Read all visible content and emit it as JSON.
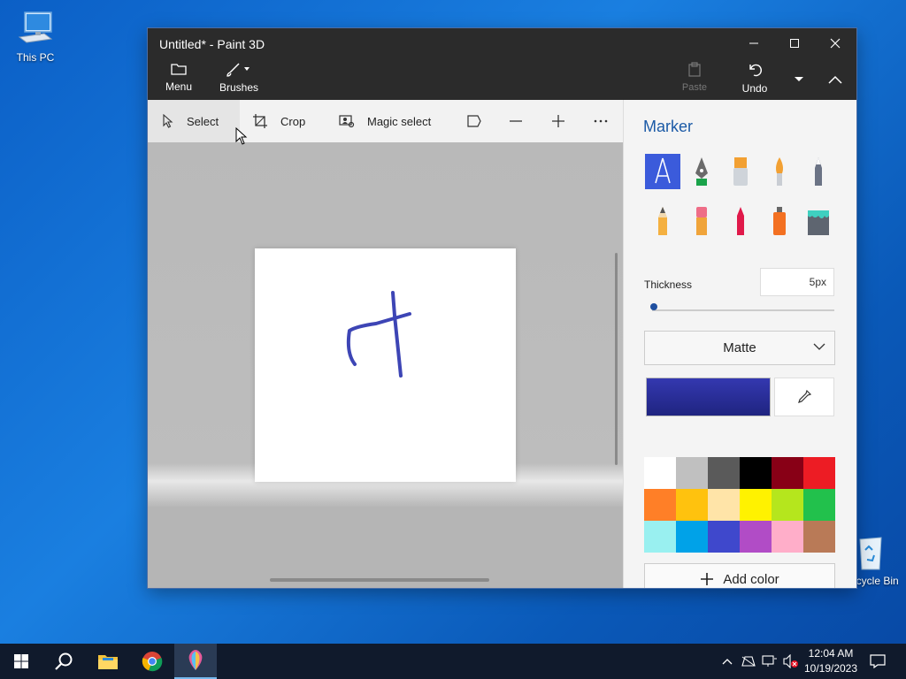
{
  "desktop": {
    "this_pc_label": "This PC",
    "recycle_label": "Recycle Bin"
  },
  "window": {
    "title": "Untitled* - Paint 3D"
  },
  "ribbon": {
    "menu_label": "Menu",
    "brushes_label": "Brushes",
    "paste_label": "Paste",
    "undo_label": "Undo"
  },
  "toolbar": {
    "select_label": "Select",
    "crop_label": "Crop",
    "magic_select_label": "Magic select"
  },
  "panel": {
    "title": "Marker",
    "thickness_label": "Thickness",
    "thickness_value": "5px",
    "finish_value": "Matte",
    "add_color_label": "Add color",
    "current_color": "#3438b0",
    "palette": [
      "#ffffff",
      "#c0c0c0",
      "#5a5a5a",
      "#000000",
      "#880016",
      "#ed1c24",
      "#ff7f27",
      "#ffc20e",
      "#ffe4a8",
      "#fff200",
      "#b5e61d",
      "#22c14c",
      "#99f0f0",
      "#00a2e8",
      "#3f48cc",
      "#b14cc6",
      "#ffaec9",
      "#b97a57"
    ]
  },
  "taskbar": {
    "time": "12:04 AM",
    "date": "10/19/2023"
  }
}
